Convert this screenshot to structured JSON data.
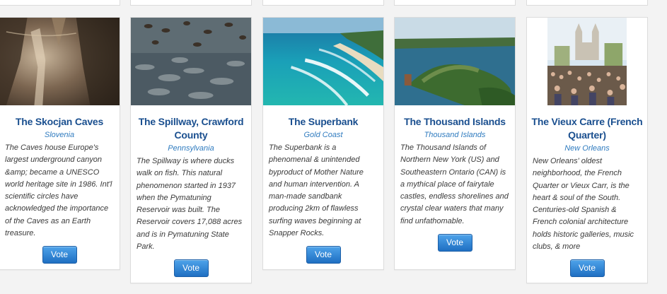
{
  "cards": [
    {
      "title": "The Skocjan Caves",
      "location": "Slovenia",
      "description": "The Caves house Europe's largest underground canyon &amp; became a UNESCO world heritage site in 1986. Int'l scientific circles have acknowledged the importance of the Caves as an Earth treasure.",
      "vote_label": "Vote"
    },
    {
      "title": "The Spillway, Crawford County",
      "location": "Pennsylvania",
      "description": "The Spillway is where ducks walk on fish. This natural phenomenon started in 1937 when the Pymatuning Reservoir was built. The Reservoir covers 17,088 acres and is in Pymatuning State Park.",
      "vote_label": "Vote"
    },
    {
      "title": "The Superbank",
      "location": "Gold Coast",
      "description": "The Superbank is a phenomenal & unintended byproduct of Mother Nature and human intervention. A man-made sandbank producing 2km of flawless surfing waves beginning at Snapper Rocks.",
      "vote_label": "Vote"
    },
    {
      "title": "The Thousand Islands",
      "location": "Thousand Islands",
      "description": "The Thousand Islands of Northern New York (US) and Southeastern Ontario (CAN) is a mythical place of fairytale castles, endless shorelines and crystal clear waters that many find unfathomable.",
      "vote_label": "Vote"
    },
    {
      "title": "The Vieux Carre (French Quarter)",
      "location": "New Orleans",
      "description": "New Orleans' oldest neighborhood, the French Quarter or Vieux Carr, is the heart & soul of the South. Centuries-old Spanish & French colonial architecture holds historic galleries, music clubs, & more",
      "vote_label": "Vote"
    }
  ],
  "colors": {
    "title": "#1a4f8f",
    "location": "#2f7bbf",
    "button": "#2b82d4"
  }
}
